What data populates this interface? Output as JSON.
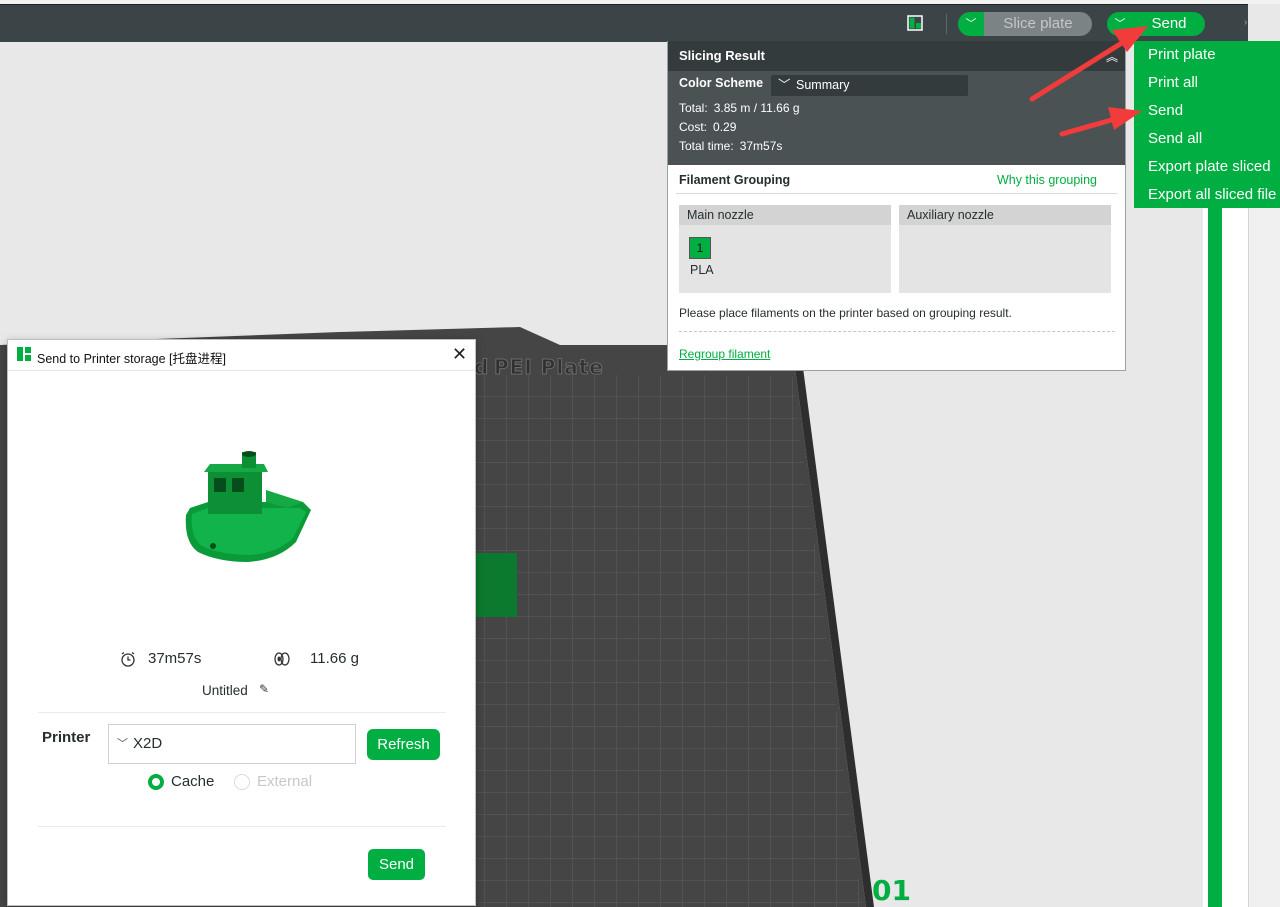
{
  "toolbar": {
    "slice_label": "Slice plate",
    "send_label": "Send",
    "icons": {
      "layout": "layout-toggle-icon",
      "dropdown": "chevron-down-icon"
    }
  },
  "send_menu": {
    "items": [
      {
        "label": "Print plate"
      },
      {
        "label": "Print all"
      },
      {
        "label": "Send"
      },
      {
        "label": "Send all"
      },
      {
        "label": "Export plate sliced"
      },
      {
        "label": "Export all sliced file"
      }
    ]
  },
  "slicing_result": {
    "title": "Slicing Result",
    "color_scheme_label": "Color Scheme",
    "color_scheme_value": "Summary",
    "total_label": "Total:",
    "total_value": "3.85 m / 11.66 g",
    "cost_label": "Cost:",
    "cost_value": "0.29",
    "time_label": "Total time:",
    "time_value": "37m57s"
  },
  "filament_grouping": {
    "title": "Filament Grouping",
    "why_link": "Why this grouping",
    "main_nozzle": "Main nozzle",
    "aux_nozzle": "Auxiliary nozzle",
    "filament_number": "1",
    "filament_type": "PLA",
    "filament_color": "#00ae42",
    "note": "Please place filaments on the printer based on grouping result.",
    "regroup_link": "Regroup filament"
  },
  "plate": {
    "label": "PEI Plate",
    "prefix": "d",
    "plate_number": "01"
  },
  "dialog": {
    "title": "Send to Printer storage [托盘进程]",
    "print_time": "37m57s",
    "weight": "11.66 g",
    "project_name": "Untitled",
    "printer_label": "Printer",
    "printer_value": "X2D",
    "refresh_label": "Refresh",
    "radio_cache": "Cache",
    "radio_external": "External",
    "send_label": "Send"
  },
  "colors": {
    "accent": "#00ae42",
    "toolbar": "#3b4446",
    "panel_dark": "#4a5254",
    "plate": "#434343"
  }
}
